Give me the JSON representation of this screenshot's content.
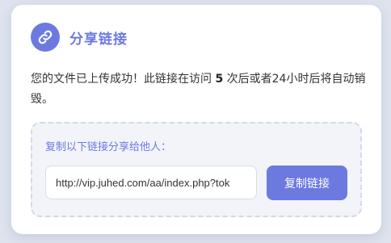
{
  "header": {
    "icon": "link-icon",
    "title": "分享链接"
  },
  "message": {
    "before": "您的文件已上传成功！此链接在访问 ",
    "count": "5",
    "after": " 次后或者24小时后将自动销毁。"
  },
  "share": {
    "label": "复制以下链接分享给他人：",
    "link_value": "http://vip.juhed.com/aa/index.php?tok",
    "copy_button_label": "复制链接"
  },
  "colors": {
    "accent": "#6c7ae0",
    "background": "#dee3ee",
    "box_background": "#f2f4f9"
  }
}
